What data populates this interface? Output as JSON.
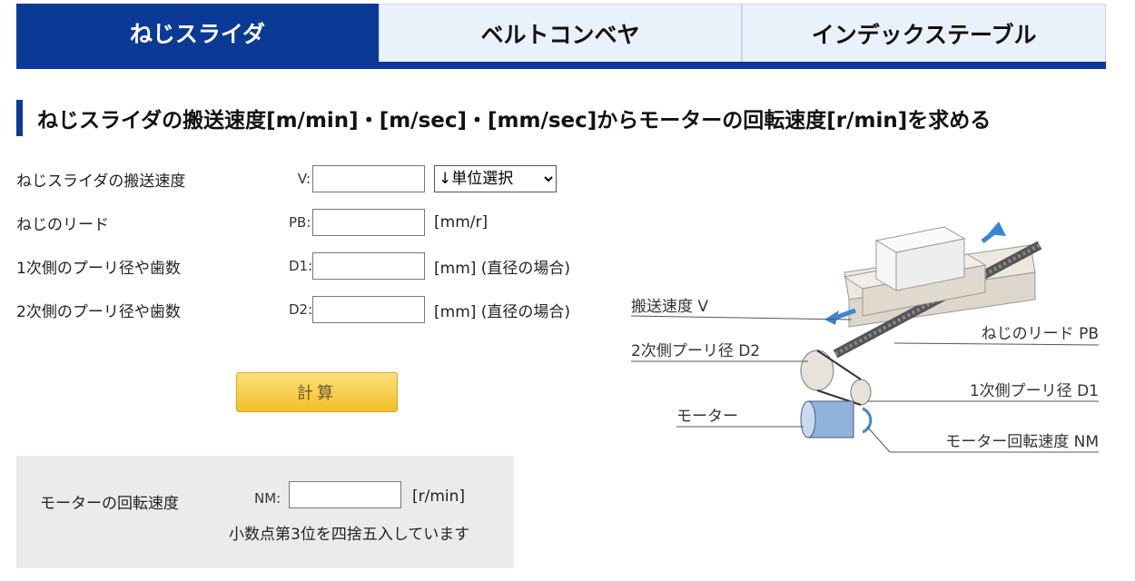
{
  "tabs": [
    {
      "label": "ねじスライダ",
      "active": true
    },
    {
      "label": "ベルトコンベヤ",
      "active": false
    },
    {
      "label": "インデックステーブル",
      "active": false
    }
  ],
  "heading": "ねじスライダの搬送速度[m/min]・[m/sec]・[mm/sec]からモーターの回転速度[r/min]を求める",
  "form": {
    "speed": {
      "label": "ねじスライダの搬送速度",
      "symbol": "V:",
      "value": "",
      "unit_select": "↓単位選択"
    },
    "lead": {
      "label": "ねじのリード",
      "symbol": "PB:",
      "value": "",
      "unit": "[mm/r]"
    },
    "pulley1": {
      "label": "1次側のプーリ径や歯数",
      "symbol": "D1:",
      "value": "",
      "unit": "[mm] (直径の場合)"
    },
    "pulley2": {
      "label": "2次側のプーリ径や歯数",
      "symbol": "D2:",
      "value": "",
      "unit": "[mm] (直径の場合)"
    }
  },
  "calc_button": "計算",
  "result": {
    "label": "モーターの回転速度",
    "symbol": "NM:",
    "value": "",
    "unit": "[r/min]",
    "note": "小数点第3位を四捨五入しています"
  },
  "diagram": {
    "labels": {
      "speed": "搬送速度 V",
      "lead": "ねじのリード PB",
      "pulley2": "2次側プーリ径 D2",
      "pulley1": "1次側プーリ径 D1",
      "motor": "モーター",
      "motor_speed": "モーター回転速度 NM"
    }
  },
  "colors": {
    "brand_blue": "#0a3a96",
    "tab_inactive_bg": "#e9f1fb",
    "button_yellow": "#f3bf2b",
    "arrow_blue": "#3a86d6"
  }
}
